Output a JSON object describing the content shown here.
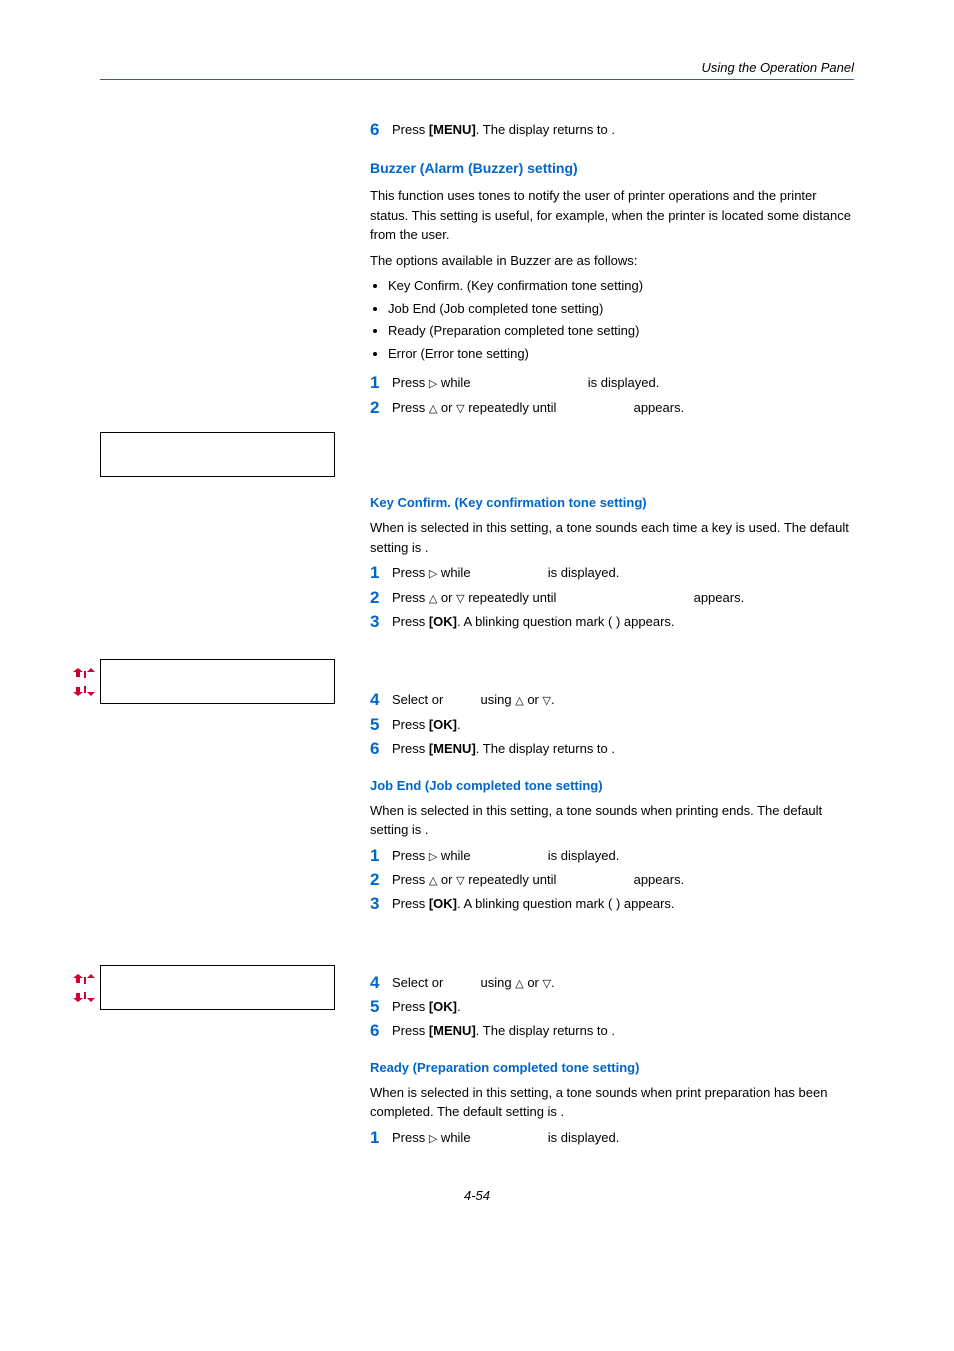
{
  "header": {
    "section": "Using the Operation Panel"
  },
  "intro_step": {
    "num": "6",
    "text_a": "Press ",
    "bold": "[MENU]",
    "text_b": ". The display returns to ",
    "tail": "."
  },
  "buzzer": {
    "title": "Buzzer (Alarm (Buzzer) setting)",
    "p1": "This function uses tones to notify the user of printer operations and the printer status. This setting is useful, for example, when the printer is located some distance from the user.",
    "p2": "The options available in Buzzer are as follows:",
    "bullets": [
      "Key Confirm. (Key confirmation tone setting)",
      "Job End (Job completed tone setting)",
      "Ready (Preparation completed tone setting)",
      "Error (Error tone setting)"
    ],
    "step1": {
      "num": "1",
      "a": "Press ",
      "b": " while ",
      "c": " is displayed."
    },
    "step2": {
      "num": "2",
      "a": "Press ",
      "mid": " or ",
      "b": " repeatedly until ",
      "c": " appears."
    }
  },
  "keyconfirm": {
    "title": "Key Confirm. (Key confirmation tone setting)",
    "p1a": "When ",
    "p1b": " is selected in this setting, a tone sounds each time a key is used. The default setting is ",
    "p1c": ".",
    "step1": {
      "num": "1",
      "a": "Press ",
      "b": " while ",
      "c": " is displayed."
    },
    "step2": {
      "num": "2",
      "a": "Press ",
      "mid": " or ",
      "b": " repeatedly until ",
      "c": " appears."
    },
    "step3": {
      "num": "3",
      "a": "Press ",
      "bold": "[OK]",
      "b": ". A blinking question mark ( ) appears."
    },
    "step4": {
      "num": "4",
      "a": "Select ",
      "or": " or ",
      "b": " using ",
      "mid": " or ",
      "c": "."
    },
    "step5": {
      "num": "5",
      "a": "Press ",
      "bold": "[OK]",
      "b": "."
    },
    "step6": {
      "num": "6",
      "a": "Press ",
      "bold": "[MENU]",
      "b": ". The display returns to ",
      "c": "."
    }
  },
  "jobend": {
    "title": "Job End (Job completed tone setting)",
    "p1a": "When ",
    "p1b": " is selected in this setting, a tone sounds when printing ends. The default setting is ",
    "p1c": ".",
    "step1": {
      "num": "1",
      "a": "Press ",
      "b": " while ",
      "c": " is displayed."
    },
    "step2": {
      "num": "2",
      "a": "Press ",
      "mid": " or ",
      "b": " repeatedly until ",
      "c": " appears."
    },
    "step3": {
      "num": "3",
      "a": "Press ",
      "bold": "[OK]",
      "b": ". A blinking question mark ( ) appears."
    },
    "step4": {
      "num": "4",
      "a": "Select ",
      "or": " or ",
      "b": " using ",
      "mid": " or ",
      "c": "."
    },
    "step5": {
      "num": "5",
      "a": "Press ",
      "bold": "[OK]",
      "b": "."
    },
    "step6": {
      "num": "6",
      "a": "Press ",
      "bold": "[MENU]",
      "b": ". The display returns to ",
      "c": "."
    }
  },
  "ready": {
    "title": "Ready (Preparation completed tone setting)",
    "p1a": "When ",
    "p1b": " is selected in this setting, a tone sounds when print preparation has been completed. The default setting is ",
    "p1c": ".",
    "step1": {
      "num": "1",
      "a": "Press ",
      "b": " while ",
      "c": " is displayed."
    }
  },
  "page_number": "4-54"
}
